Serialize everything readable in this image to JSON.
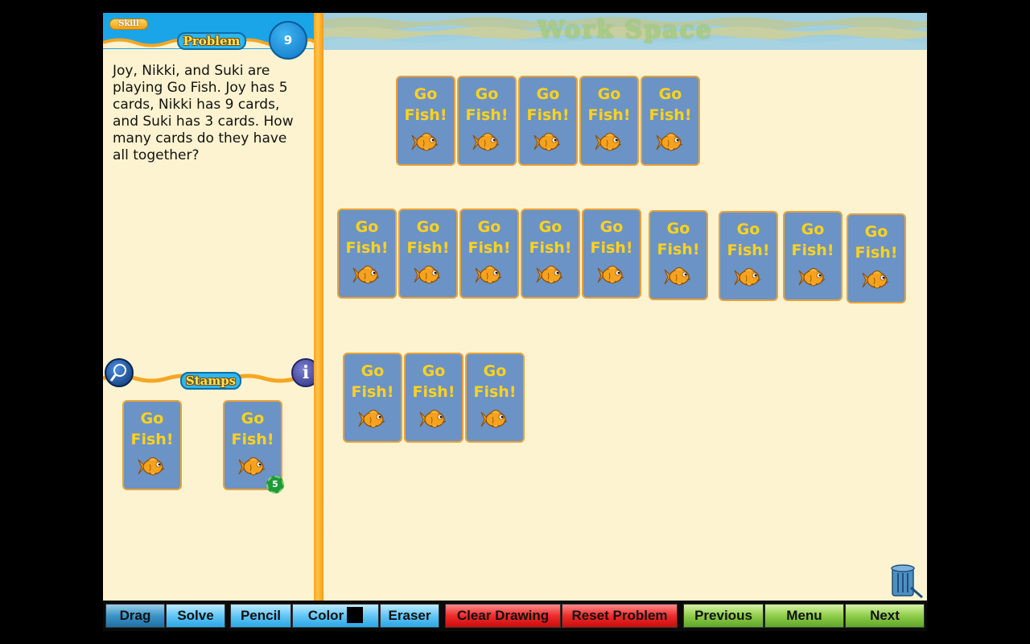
{
  "left_panel": {
    "skill_label": "Skill",
    "problem_label": "Problem",
    "problem_number": "9",
    "problem_text": "Joy, Nikki, and Suki are playing Go Fish. Joy has 5 cards, Nikki has 9 cards, and Suki has 3 cards. How many cards do they have all together?",
    "stamps_label": "Stamps",
    "info_label": "i"
  },
  "stamps": [
    {
      "line1": "Go",
      "line2": "Fish!",
      "badge": ""
    },
    {
      "line1": "Go",
      "line2": "Fish!",
      "badge": "5"
    }
  ],
  "workspace": {
    "title": "Work Space",
    "cards": [
      {
        "line1": "Go",
        "line2": "Fish!"
      },
      {
        "line1": "Go",
        "line2": "Fish!"
      },
      {
        "line1": "Go",
        "line2": "Fish!"
      },
      {
        "line1": "Go",
        "line2": "Fish!"
      },
      {
        "line1": "Go",
        "line2": "Fish!"
      },
      {
        "line1": "Go",
        "line2": "Fish!"
      },
      {
        "line1": "Go",
        "line2": "Fish!"
      },
      {
        "line1": "Go",
        "line2": "Fish!"
      },
      {
        "line1": "Go",
        "line2": "Fish!"
      },
      {
        "line1": "Go",
        "line2": "Fish!"
      },
      {
        "line1": "Go",
        "line2": "Fish!"
      },
      {
        "line1": "Go",
        "line2": "Fish!"
      },
      {
        "line1": "Go",
        "line2": "Fish!"
      },
      {
        "line1": "Go",
        "line2": "Fish!"
      },
      {
        "line1": "Go",
        "line2": "Fish!"
      },
      {
        "line1": "Go",
        "line2": "Fish!"
      },
      {
        "line1": "Go",
        "line2": "Fish!"
      }
    ]
  },
  "toolbar": {
    "drag": "Drag",
    "solve": "Solve",
    "pencil": "Pencil",
    "color": "Color",
    "eraser": "Eraser",
    "clear_drawing": "Clear Drawing",
    "reset_problem": "Reset Problem",
    "previous": "Previous",
    "menu": "Menu",
    "next": "Next"
  },
  "colors": {
    "card_bg": "#6b93c5",
    "card_text": "#ffd21f",
    "card_border": "#e9a238",
    "pencil_color": "#000000"
  }
}
